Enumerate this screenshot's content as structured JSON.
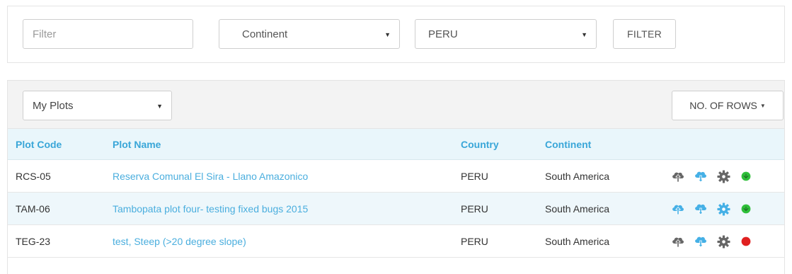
{
  "filter_bar": {
    "filter_placeholder": "Filter",
    "continent_value": "Continent",
    "country_value": "PERU",
    "filter_button": "FILTER"
  },
  "plots_toolbar": {
    "myplots_value": "My Plots",
    "rows_button": "NO. OF ROWS"
  },
  "table": {
    "headers": {
      "code": "Plot Code",
      "name": "Plot Name",
      "country": "Country",
      "continent": "Continent"
    },
    "rows": [
      {
        "code": "RCS-05",
        "name": "Reserva Comunal El Sira - Llano Amazonico",
        "country": "PERU",
        "continent": "South America",
        "upload_active": false,
        "settings_active": false,
        "status_color": "#2fbf3a"
      },
      {
        "code": "TAM-06",
        "name": "Tambopata plot four- testing fixed bugs 2015",
        "country": "PERU",
        "continent": "South America",
        "upload_active": true,
        "settings_active": true,
        "status_color": "#2fbf3a"
      },
      {
        "code": "TEG-23",
        "name": "test, Steep (>20 degree slope)",
        "country": "PERU",
        "continent": "South America",
        "upload_active": false,
        "settings_active": false,
        "status_color": "#e02020"
      }
    ]
  },
  "colors": {
    "accent": "#39a6d8",
    "icon_active": "#45b0e6",
    "icon_inactive": "#666666"
  }
}
